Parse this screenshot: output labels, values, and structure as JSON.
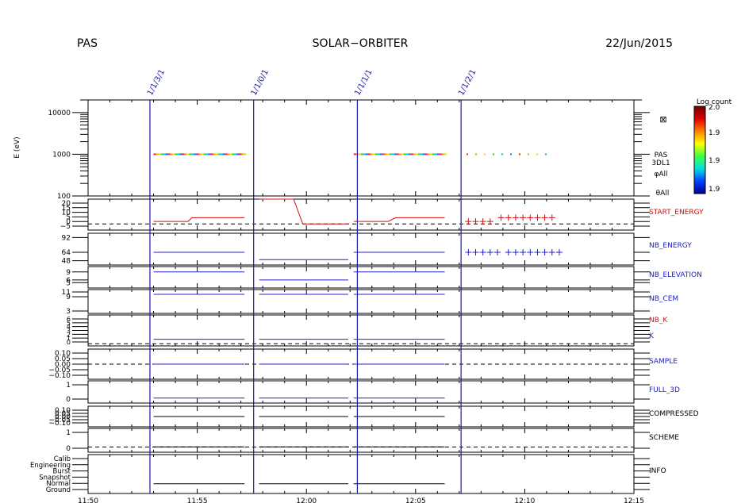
{
  "header": {
    "left": "PAS",
    "center": "SOLAR−ORBITER",
    "right": "22/Jun/2015"
  },
  "colors": {
    "axis": "#000000",
    "marker": "#1a1aa0",
    "blue": "#2020c8",
    "red": "#d01010",
    "black": "#000000"
  },
  "chart_data": {
    "type": "line",
    "time_axis": {
      "range": [
        "11:50",
        "12:15"
      ],
      "ticks": [
        "11:50",
        "11:55",
        "12:00",
        "12:05",
        "12:10",
        "12:15"
      ]
    },
    "markers": [
      {
        "time": "11:52:50",
        "label": "1/1/3/1"
      },
      {
        "time": "11:57:35",
        "label": "1/1/0/1"
      },
      {
        "time": "12:02:20",
        "label": "1/1/1/1"
      },
      {
        "time": "12:07:05",
        "label": "1/1/2/1"
      }
    ],
    "colorbar": {
      "title": "Log count",
      "ticks": [
        "2.0",
        "1.9",
        "1.9",
        "1.9"
      ]
    },
    "panels": [
      {
        "id": "spectrogram",
        "ylabel": "E (eV)",
        "scale": "log",
        "ylim": [
          100,
          20000
        ],
        "ticks": [
          "10000",
          "1000",
          "100"
        ],
        "right_labels": [
          "PAS",
          "3DL1",
          "φAll",
          "θAll"
        ],
        "right_symbol": "⊠",
        "segments": [
          {
            "start": "11:53:00",
            "end": "11:57:10",
            "energy": 1000,
            "style": "dense"
          },
          {
            "start": "12:02:10",
            "end": "12:06:20",
            "energy": 1000,
            "style": "dense"
          },
          {
            "start": "12:07:20",
            "end": "12:11:00",
            "energy": 1000,
            "style": "sparse"
          }
        ]
      },
      {
        "id": "start_energy",
        "label": "START_ENERGY",
        "label_color": "red",
        "ticks": [
          "20",
          "15",
          "10",
          "5",
          "0",
          "−5"
        ],
        "ylim": [
          -5,
          20
        ],
        "zero_line": true,
        "lines": [
          {
            "color": "red",
            "points": [
              [
                "11:53:00",
                2
              ],
              [
                "11:54:35",
                2
              ],
              [
                "11:54:45",
                5
              ],
              [
                "11:57:10",
                5
              ]
            ]
          },
          {
            "color": "red",
            "points": [
              [
                "11:57:50",
                20
              ],
              [
                "11:59:25",
                20
              ],
              [
                "11:59:50",
                0
              ],
              [
                "12:01:55",
                0
              ]
            ]
          },
          {
            "color": "red",
            "points": [
              [
                "12:02:10",
                2
              ],
              [
                "12:03:45",
                2
              ],
              [
                "12:04:05",
                5
              ],
              [
                "12:06:20",
                5
              ]
            ]
          }
        ],
        "crosses": {
          "color": "red",
          "points": [
            [
              "12:07:25",
              2
            ],
            [
              "12:07:45",
              2
            ],
            [
              "12:08:05",
              2
            ],
            [
              "12:08:25",
              2
            ],
            [
              "12:08:55",
              5
            ],
            [
              "12:09:15",
              5
            ],
            [
              "12:09:35",
              5
            ],
            [
              "12:09:55",
              5
            ],
            [
              "12:10:15",
              5
            ],
            [
              "12:10:35",
              5
            ],
            [
              "12:10:55",
              5
            ],
            [
              "12:11:15",
              5
            ]
          ]
        }
      },
      {
        "id": "nb_energy",
        "label": "NB_ENERGY",
        "label_color": "blue",
        "ticks": [
          "92",
          "64",
          "48"
        ],
        "tick_values": [
          92,
          64,
          48
        ],
        "ylim": [
          40,
          100
        ],
        "zero_line": false,
        "lines": [
          {
            "color": "blue",
            "points": [
              [
                "11:53:00",
                64
              ],
              [
                "11:57:10",
                64
              ]
            ]
          },
          {
            "color": "blue",
            "points": [
              [
                "11:57:50",
                50
              ],
              [
                "12:01:55",
                50
              ]
            ]
          },
          {
            "color": "blue",
            "points": [
              [
                "12:02:10",
                64
              ],
              [
                "12:06:20",
                64
              ]
            ]
          }
        ],
        "crosses": {
          "color": "blue",
          "points": [
            [
              "12:07:25",
              64
            ],
            [
              "12:07:45",
              64
            ],
            [
              "12:08:05",
              64
            ],
            [
              "12:08:25",
              64
            ],
            [
              "12:08:45",
              64
            ],
            [
              "12:09:15",
              64
            ],
            [
              "12:09:35",
              64
            ],
            [
              "12:09:55",
              64
            ],
            [
              "12:10:15",
              64
            ],
            [
              "12:10:35",
              64
            ],
            [
              "12:10:55",
              64
            ],
            [
              "12:11:15",
              64
            ],
            [
              "12:11:35",
              64
            ]
          ]
        }
      },
      {
        "id": "nb_elevation",
        "label": "NB_ELEVATION",
        "label_color": "blue",
        "ticks": [
          "9",
          "6",
          "5"
        ],
        "tick_values": [
          9,
          6,
          5
        ],
        "ylim": [
          3,
          11
        ],
        "zero_line": false,
        "lines": [
          {
            "color": "blue",
            "points": [
              [
                "11:53:00",
                9
              ],
              [
                "11:57:10",
                9
              ]
            ]
          },
          {
            "color": "blue",
            "points": [
              [
                "11:57:50",
                6
              ],
              [
                "12:01:55",
                6
              ]
            ]
          },
          {
            "color": "blue",
            "points": [
              [
                "12:02:10",
                9
              ],
              [
                "12:06:20",
                9
              ]
            ]
          }
        ]
      },
      {
        "id": "nb_cem",
        "label": "NB_CEM",
        "label_color": "blue",
        "ticks": [
          "11",
          "9",
          "3"
        ],
        "tick_values": [
          11,
          9,
          3
        ],
        "ylim": [
          2,
          12
        ],
        "zero_line": false,
        "lines": [
          {
            "color": "blue",
            "points": [
              [
                "11:53:00",
                10
              ],
              [
                "11:57:10",
                10
              ]
            ]
          },
          {
            "color": "blue",
            "points": [
              [
                "11:57:50",
                10
              ],
              [
                "12:01:55",
                10
              ]
            ]
          },
          {
            "color": "blue",
            "points": [
              [
                "12:02:10",
                10
              ],
              [
                "12:06:20",
                10
              ]
            ]
          }
        ]
      },
      {
        "id": "nb_k",
        "label": "NB_K",
        "label_color": "red",
        "label2": "K",
        "label2_color": "blue",
        "ticks": [
          "6",
          "5",
          "4",
          "3",
          "2",
          "1",
          "0"
        ],
        "ylim": [
          -0.5,
          6.5
        ],
        "zero_line": true,
        "lines": [
          {
            "color": "blue",
            "points": [
              [
                "11:53:00",
                1
              ],
              [
                "11:57:10",
                1
              ]
            ]
          },
          {
            "color": "blue",
            "points": [
              [
                "11:57:50",
                1
              ],
              [
                "12:01:55",
                1
              ]
            ]
          },
          {
            "color": "blue",
            "points": [
              [
                "12:02:10",
                1
              ],
              [
                "12:06:20",
                1
              ]
            ]
          }
        ]
      },
      {
        "id": "sample",
        "label": "SAMPLE",
        "label_color": "blue",
        "ticks": [
          "0.10",
          "0.05",
          "0.00",
          "−0.05",
          "−0.10"
        ],
        "ylim": [
          -0.11,
          0.11
        ],
        "zero_line": true,
        "lines": [
          {
            "color": "blue",
            "points": [
              [
                "11:53:00",
                0
              ],
              [
                "11:57:10",
                0
              ]
            ]
          },
          {
            "color": "blue",
            "points": [
              [
                "11:57:50",
                0
              ],
              [
                "12:01:55",
                0
              ]
            ]
          },
          {
            "color": "blue",
            "points": [
              [
                "12:02:10",
                0
              ],
              [
                "12:06:20",
                0
              ]
            ]
          }
        ]
      },
      {
        "id": "full_3d",
        "label": "FULL_3D",
        "label_color": "blue",
        "ticks": [
          "1",
          "0"
        ],
        "ylim": [
          -0.4,
          1.4
        ],
        "zero_line": false,
        "lines": [
          {
            "color": "blue",
            "points": [
              [
                "11:53:00",
                0
              ],
              [
                "11:57:10",
                0
              ]
            ]
          },
          {
            "color": "blue",
            "points": [
              [
                "11:57:50",
                0
              ],
              [
                "12:01:55",
                0
              ]
            ]
          },
          {
            "color": "blue",
            "points": [
              [
                "12:02:10",
                0
              ],
              [
                "12:06:20",
                0
              ]
            ]
          }
        ]
      },
      {
        "id": "compressed",
        "label": "COMPRESSED",
        "label_color": "black",
        "ticks": [
          "0.10",
          "0.05",
          "0.00",
          "−0.05",
          "−0.10"
        ],
        "ylim": [
          -0.12,
          0.12
        ],
        "zero_line": false,
        "lines": [
          {
            "color": "black",
            "points": [
              [
                "11:53:00",
                0
              ],
              [
                "11:57:10",
                0
              ]
            ]
          },
          {
            "color": "black",
            "points": [
              [
                "11:57:50",
                0
              ],
              [
                "12:01:55",
                0
              ]
            ]
          },
          {
            "color": "black",
            "points": [
              [
                "12:02:10",
                0
              ],
              [
                "12:06:20",
                0
              ]
            ]
          }
        ]
      },
      {
        "id": "scheme",
        "label": "SCHEME",
        "label_color": "black",
        "ticks": [
          "1",
          "0"
        ],
        "ylim": [
          -0.4,
          1.4
        ],
        "zero_line": true,
        "lines": [
          {
            "color": "black",
            "points": [
              [
                "11:53:00",
                0
              ],
              [
                "11:57:10",
                0
              ]
            ]
          },
          {
            "color": "black",
            "points": [
              [
                "11:57:50",
                0
              ],
              [
                "12:01:55",
                0
              ]
            ]
          },
          {
            "color": "black",
            "points": [
              [
                "12:02:10",
                0
              ],
              [
                "12:06:20",
                0
              ]
            ]
          }
        ]
      },
      {
        "id": "info",
        "label": "INFO",
        "label_color": "black",
        "ticks": [
          "Calib",
          "Engineering",
          "Burst",
          "Snapshot",
          "Normal",
          "Ground"
        ],
        "ylim": [
          -0.5,
          5.5
        ],
        "zero_line": false,
        "lines": [
          {
            "color": "black",
            "points": [
              [
                "11:53:00",
                1
              ],
              [
                "11:57:10",
                1
              ]
            ]
          },
          {
            "color": "black",
            "points": [
              [
                "11:57:50",
                1
              ],
              [
                "12:01:55",
                1
              ]
            ]
          },
          {
            "color": "black",
            "points": [
              [
                "12:02:10",
                1
              ],
              [
                "12:06:20",
                1
              ]
            ]
          }
        ]
      }
    ]
  }
}
